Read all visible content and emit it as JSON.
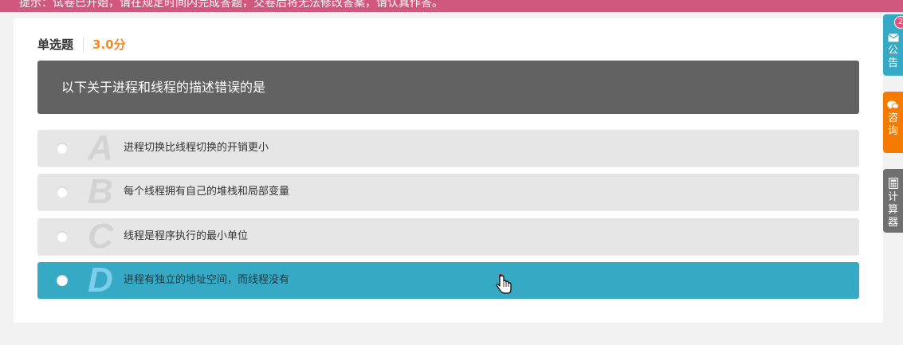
{
  "banner": {
    "text": "提示：试卷已开始，请在规定时间内完成答题，交卷后将无法修改答案，请认真作答。"
  },
  "question": {
    "type_label": "单选题",
    "score": "3.0分",
    "stem": "以下关于进程和线程的描述错误的是",
    "options": [
      {
        "letter": "A",
        "text": "进程切换比线程切换的开销更小",
        "selected": false
      },
      {
        "letter": "B",
        "text": "每个线程拥有自己的堆栈和局部变量",
        "selected": false
      },
      {
        "letter": "C",
        "text": "线程是程序执行的最小单位",
        "selected": false
      },
      {
        "letter": "D",
        "text": "进程有独立的地址空间，而线程没有",
        "selected": true
      }
    ]
  },
  "side_tabs": {
    "notice": {
      "label": "公告",
      "badge": "2",
      "color": "#36aac4",
      "icon": "envelope-icon"
    },
    "consult": {
      "label": "咨询",
      "color": "#f47b00",
      "icon": "chat-bubble-icon"
    },
    "calculator": {
      "label": "计算器",
      "color": "#707070",
      "icon": "calculator-icon"
    }
  },
  "colors": {
    "banner": "#d0577e",
    "score": "#f38b1e",
    "stem_bg": "#626262",
    "option_bg": "#e6e6e6",
    "option_selected_bg": "#36aac4"
  }
}
